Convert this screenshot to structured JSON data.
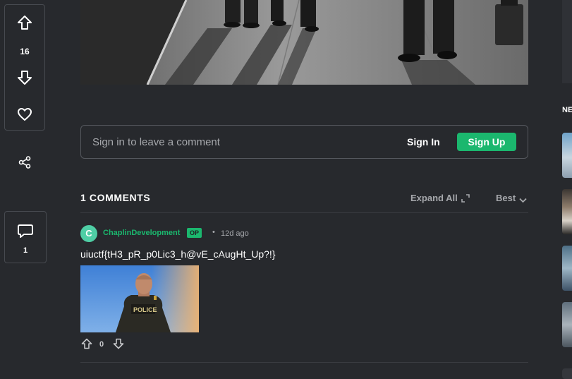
{
  "post": {
    "upvote_count": "16",
    "comment_count": "1"
  },
  "signin_bar": {
    "prompt": "Sign in to leave a comment",
    "signin_label": "Sign In",
    "signup_label": "Sign Up"
  },
  "comments_header": {
    "title": "1 COMMENTS",
    "expand_label": "Expand All",
    "sort_label": "Best"
  },
  "comment": {
    "avatar_letter": "C",
    "author": "ChaplinDevelopment",
    "op_badge": "OP",
    "separator": "•",
    "time": "12d ago",
    "text": "uiuctf{tH3_pR_p0Lic3_h@vE_cAugHt_Up?!}",
    "image_badge_text": "POLICE",
    "vote_count": "0"
  },
  "sidebar": {
    "heading": "NE"
  },
  "colors": {
    "background": "#27292d",
    "accent_green": "#1bb76e",
    "muted_text": "#a6a8ac",
    "border": "#474a50"
  },
  "icons": [
    "upvote-arrow-icon",
    "downvote-arrow-icon",
    "heart-icon",
    "share-icon",
    "comment-bubble-icon",
    "expand-icon",
    "chevron-down-icon"
  ]
}
